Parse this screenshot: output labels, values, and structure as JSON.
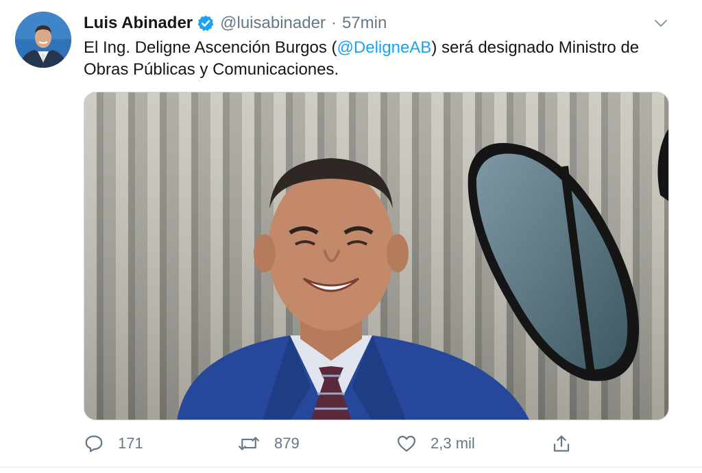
{
  "tweet": {
    "display_name": "Luis Abinader",
    "handle": "@luisabinader",
    "separator": "·",
    "time": "57min",
    "text_before": "El Ing. Deligne Ascención Burgos (",
    "mention": "@DeligneAB",
    "text_after": ") será designado Ministro de Obras Públicas y Comunicaciones.",
    "verified": true
  },
  "actions": {
    "reply_count": "171",
    "retweet_count": "879",
    "like_count": "2,3 mil",
    "icons": [
      "reply-icon",
      "retweet-icon",
      "like-icon",
      "share-icon"
    ]
  },
  "colors": {
    "link": "#1da1f2",
    "secondary_text": "#657786",
    "primary_text": "#14171a",
    "verified_badge": "#1da1f2"
  }
}
